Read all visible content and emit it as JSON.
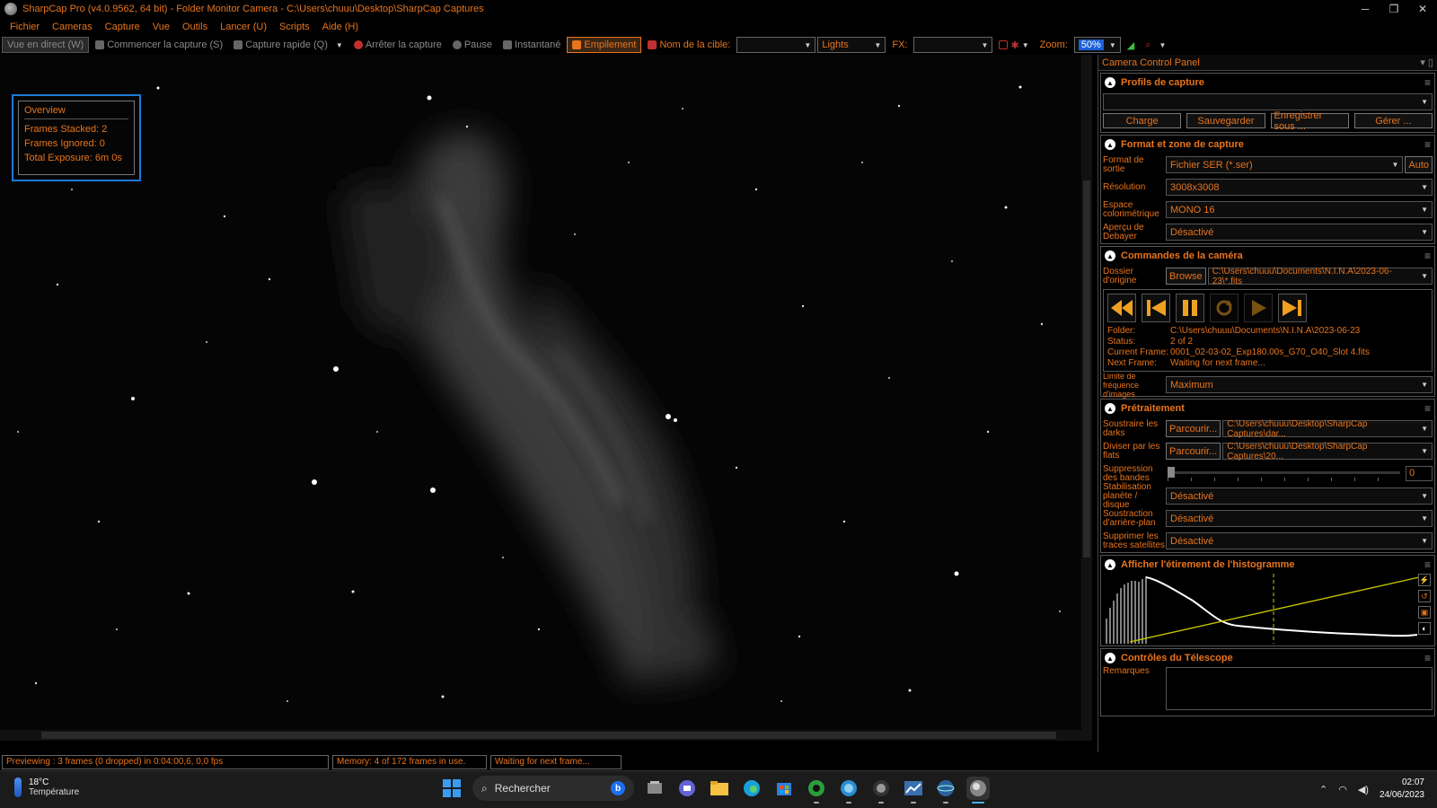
{
  "window": {
    "title": "SharpCap Pro (v4.0.9562, 64 bit) - Folder Monitor Camera - C:\\Users\\chuuu\\Desktop\\SharpCap Captures"
  },
  "menu": [
    "Fichier",
    "Cameras",
    "Capture",
    "Vue",
    "Outils",
    "Lancer (U)",
    "Scripts",
    "Aide (H)"
  ],
  "toolbar": {
    "live": "Vue en direct (W)",
    "start": "Commencer la capture (S)",
    "quick": "Capture rapide (Q)",
    "stop": "Arrêter la capture",
    "pause": "Pause",
    "snapshot": "Instantané",
    "stack": "Empilement",
    "target_label": "Nom de la cible:",
    "target_value": "",
    "frame_type": "Lights",
    "fx_label": "FX:",
    "fx_value": "",
    "zoom_label": "Zoom:",
    "zoom_value": "50%"
  },
  "overview": {
    "title": "Overview",
    "stacked": "Frames Stacked: 2",
    "ignored": "Frames Ignored: 0",
    "exposure": "Total Exposure:   6m 0s"
  },
  "panel": {
    "title": "Camera Control Panel",
    "profiles": {
      "title": "Profils de capture",
      "selected": "",
      "buttons": [
        "Charge",
        "Sauvegarder",
        "Enregistrer sous ...",
        "Gérer ..."
      ]
    },
    "format": {
      "title": "Format et zone de capture",
      "output_label": "Format de sortie",
      "output_value": "Fichier SER (*.ser)",
      "auto": "Auto",
      "resolution_label": "Résolution",
      "resolution_value": "3008x3008",
      "colorspace_label": "Espace colorimétrique",
      "colorspace_value": "MONO 16",
      "debayer_label": "Aperçu de Debayer",
      "debayer_value": "Désactivé"
    },
    "camera": {
      "title": "Commandes de la caméra",
      "source_label": "Dossier d'origine",
      "browse": "Browse",
      "source_value": "C:\\Users\\chuuu\\Documents\\N.I.N.A\\2023-06-23\\*.fits",
      "folder_key": "Folder:",
      "folder_val": "C:\\Users\\chuuu\\Documents\\N.I.N.A\\2023-06-23",
      "status_key": "Status:",
      "status_val": "2 of 2",
      "current_key": "Current Frame:",
      "current_val": "0001_02-03-02_Exp180.00s_G70_O40_Slot 4.fits",
      "next_key": "Next Frame:",
      "next_val": "Waiting for next frame...",
      "rate_label": "Limite de fréquence d'images",
      "rate_value": "Maximum"
    },
    "preprocess": {
      "title": "Prétraitement",
      "darks_label": "Soustraire les darks",
      "darks_btn": "Parcourir...",
      "darks_value": "C:\\Users\\chuuu\\Desktop\\SharpCap Captures\\dar...",
      "flats_label": "Diviser par les flats",
      "flats_btn": "Parcourir...",
      "flats_value": "C:\\Users\\chuuu\\Desktop\\SharpCap Captures\\20...",
      "banding_label": "Suppression des bandes",
      "banding_value": "0",
      "stabil_label": "Stabilisation planète / disque",
      "stabil_value": "Désactivé",
      "bg_label": "Soustraction d'arrière-plan",
      "bg_value": "Désactivé",
      "sat_label": "Supprimer les traces satellites",
      "sat_value": "Désactivé"
    },
    "histogram": {
      "title": "Afficher l'étirement de l'histogramme"
    },
    "telescope": {
      "title": "Contrôles du Télescope",
      "notes_label": "Remarques"
    }
  },
  "status": {
    "preview": "Previewing : 3 frames (0 dropped) in 0:04:00,6, 0,0 fps",
    "memory": "Memory: 4 of 172 frames in use.",
    "waiting": "Waiting for next frame..."
  },
  "taskbar": {
    "temp": "18°C",
    "temp_label": "Température",
    "search": "Rechercher",
    "time": "02:07",
    "date": "24/06/2023"
  }
}
